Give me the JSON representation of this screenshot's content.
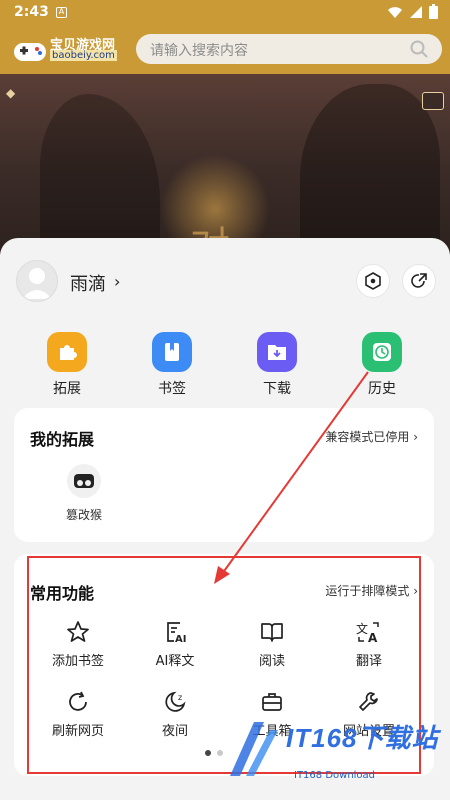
{
  "status_bar": {
    "time": "2:43"
  },
  "top_bar": {
    "logo_text": "宝贝游戏网",
    "logo_sub": "baobeiy.com",
    "search_placeholder": "请输入搜索内容"
  },
  "banner": {
    "headline_text": "对"
  },
  "profile": {
    "name": "雨滴"
  },
  "quick_actions": [
    {
      "label": "拓展",
      "icon": "puzzle-icon",
      "color": "#f4a81d"
    },
    {
      "label": "书签",
      "icon": "bookmark-book-icon",
      "color": "#3d8cf5"
    },
    {
      "label": "下载",
      "icon": "download-folder-icon",
      "color": "#6b5cf3"
    },
    {
      "label": "历史",
      "icon": "clock-icon",
      "color": "#2bbf74"
    }
  ],
  "extensions_card": {
    "title": "我的拓展",
    "status": "兼容模式已停用",
    "items": [
      {
        "label": "篡改猴",
        "icon": "tampermonkey-icon"
      }
    ]
  },
  "functions_card": {
    "title": "常用功能",
    "mode": "运行于排障模式",
    "items": [
      {
        "label": "添加书签",
        "icon": "star-icon"
      },
      {
        "label": "AI释文",
        "icon": "ai-doc-icon"
      },
      {
        "label": "阅读",
        "icon": "book-open-icon"
      },
      {
        "label": "翻译",
        "icon": "translate-icon"
      },
      {
        "label": "刷新网页",
        "icon": "refresh-icon"
      },
      {
        "label": "夜间",
        "icon": "moon-icon"
      },
      {
        "label": "工具箱",
        "icon": "toolbox-icon"
      },
      {
        "label": "网站设置",
        "icon": "wrench-icon"
      }
    ]
  },
  "pager": {
    "pages": 2,
    "current": 1
  },
  "watermark": {
    "text": "IT168下载站",
    "sub": "IT168 Download"
  },
  "colors": {
    "brand_bar": "#c99a36",
    "highlight_red": "#e53935",
    "watermark_blue": "#2f6fe0"
  }
}
